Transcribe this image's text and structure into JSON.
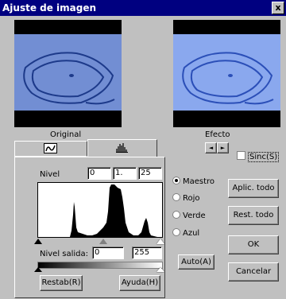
{
  "window": {
    "title": "Ajuste de imagen",
    "close": "x"
  },
  "previews": {
    "original_label": "Original",
    "effect_label": "Efecto"
  },
  "tabs": [
    {
      "icon": "curve-icon"
    },
    {
      "icon": "histogram-icon"
    }
  ],
  "scroll_arrows": {
    "left": "◄",
    "right": "►"
  },
  "sync": {
    "label": "Sinc(S)",
    "checked": false
  },
  "level": {
    "label": "Nivel",
    "low": "0",
    "gamma": "1.",
    "high": "25"
  },
  "channels": [
    {
      "label": "Maestro",
      "selected": true
    },
    {
      "label": "Rojo",
      "selected": false
    },
    {
      "label": "Verde",
      "selected": false
    },
    {
      "label": "Azul",
      "selected": false
    }
  ],
  "output": {
    "label": "Nivel salida:",
    "low": "0",
    "high": "255"
  },
  "buttons": {
    "auto": "Auto(A)",
    "restore": "Restab(R)",
    "help": "Ayuda(H)",
    "apply_all": "Aplic. todo",
    "reset_all": "Rest. todo",
    "ok": "OK",
    "cancel": "Cancelar"
  },
  "colors": {
    "titlebar": "#000080",
    "preview_blue": "#5a78c8",
    "effect_blue": "#7c9ce8"
  }
}
